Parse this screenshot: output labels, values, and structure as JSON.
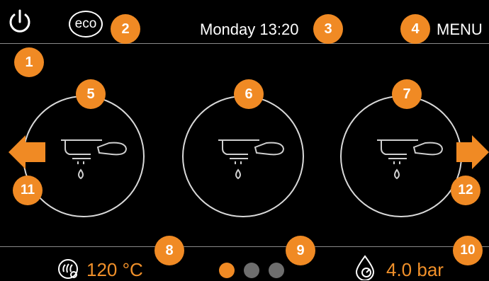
{
  "header": {
    "power_icon": "power-icon",
    "eco_label": "eco",
    "datetime": "Monday 13:20",
    "menu_label": "MENU"
  },
  "brew_groups": [
    {
      "icon": "portafilter-icon"
    },
    {
      "icon": "portafilter-icon"
    },
    {
      "icon": "portafilter-icon"
    }
  ],
  "footer": {
    "temperature": "120 °C",
    "temperature_icon": "steam-thermo-icon",
    "pressure": "4.0 bar",
    "pressure_icon": "water-drop-pressure-icon",
    "page_count": 3,
    "active_page": 1
  },
  "callouts": [
    "1",
    "2",
    "3",
    "4",
    "5",
    "6",
    "7",
    "8",
    "9",
    "10",
    "11",
    "12"
  ],
  "colors": {
    "accent": "#f08a24",
    "background": "#000000",
    "ring": "#d9d9d9",
    "dot_inactive": "#6e6e6e",
    "value_text": "#f0902a"
  }
}
